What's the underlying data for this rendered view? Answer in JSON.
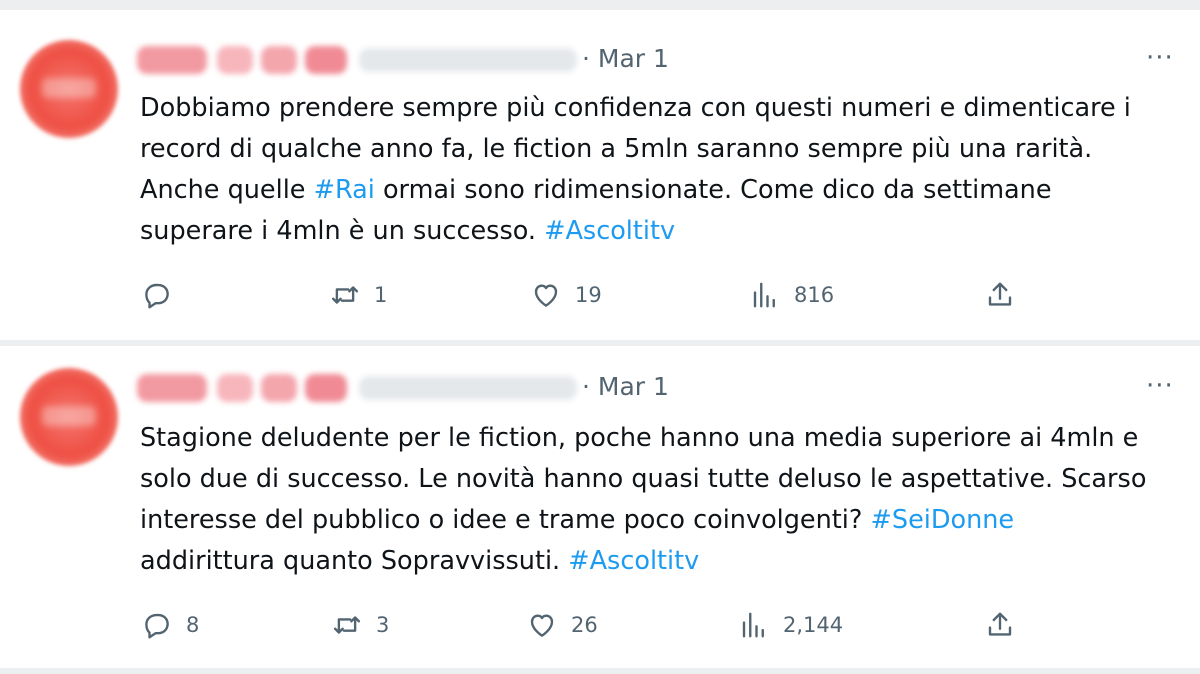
{
  "tweets": [
    {
      "date": "· Mar 1",
      "text_parts": [
        "Dobbiamo prendere sempre più confidenza con questi numeri e dimenticare i record di qualche anno fa, le fiction a 5mln saranno sempre più una rarità. Anche quelle ",
        "#Rai",
        " ormai sono ridimensionate. Come dico da settimane superare i 4mln è un successo. ",
        "#Ascoltitv"
      ],
      "replies": "",
      "retweets": "1",
      "likes": "19",
      "views": "816"
    },
    {
      "date": "· Mar 1",
      "text_parts": [
        "Stagione deludente per le fiction, poche hanno una media superiore ai 4mln e solo due di successo. Le novità hanno quasi tutte deluso le aspettative. Scarso interesse del pubblico o idee e trame poco coinvolgenti? ",
        "#SeiDonne",
        " addirittura quanto Sopravvissuti. ",
        "#Ascoltitv"
      ],
      "replies": "8",
      "retweets": "3",
      "likes": "26",
      "views": "2,144"
    }
  ],
  "more_label": "···",
  "icons": {
    "reply": "reply-icon",
    "retweet": "retweet-icon",
    "like": "heart-icon",
    "views": "views-icon",
    "share": "share-icon"
  },
  "colors": {
    "hashtag": "#1d9bf0",
    "muted": "#536471",
    "text": "#0f1419"
  }
}
